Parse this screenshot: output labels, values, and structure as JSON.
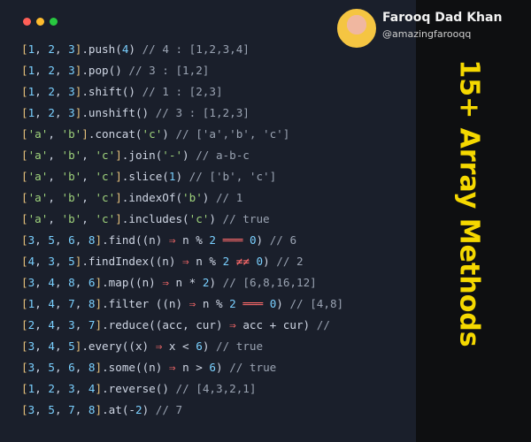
{
  "author": {
    "name": "Farooq Dad Khan",
    "handle": "@amazingfarooqq"
  },
  "title": "15+ Array Methods",
  "window_dots": [
    "#ff5f57",
    "#febc2e",
    "#28c840"
  ],
  "lines": [
    "[1, 2, 3].push(4) // 4 : [1,2,3,4]",
    "[1, 2, 3].pop() // 3 : [1,2]",
    "[1, 2, 3].shift() // 1 : [2,3]",
    "[1, 2, 3].unshift() // 3 : [1,2,3]",
    "['a', 'b'].concat('c') // ['a','b', 'c']",
    "['a', 'b', 'c'].join('-') // a-b-c",
    "['a', 'b', 'c'].slice(1) // ['b', 'c']",
    "['a', 'b', 'c'].indexOf('b') // 1",
    "['a', 'b', 'c'].includes('c') // true",
    "[3, 5, 6, 8].find((n) ⇒ n % 2 ═══ 0) // 6",
    "[4, 3, 5].findIndex((n) ⇒ n % 2 ≠≠ 0) // 2",
    "[3, 4, 8, 6].map((n) ⇒ n * 2) // [6,8,16,12]",
    "[1, 4, 7, 8].filter ((n) ⇒ n % 2 ═══ 0) // [4,8]",
    "[2, 4, 3, 7].reduce((acc, cur) ⇒ acc + cur) //",
    "[3, 4, 5].every((x) ⇒ x < 6) // true",
    "[3, 5, 6, 8].some((n) ⇒ n > 6) // true",
    "[1, 2, 3, 4].reverse() // [4,3,2,1]",
    "[3, 5, 7, 8].at(-2) // 7"
  ]
}
